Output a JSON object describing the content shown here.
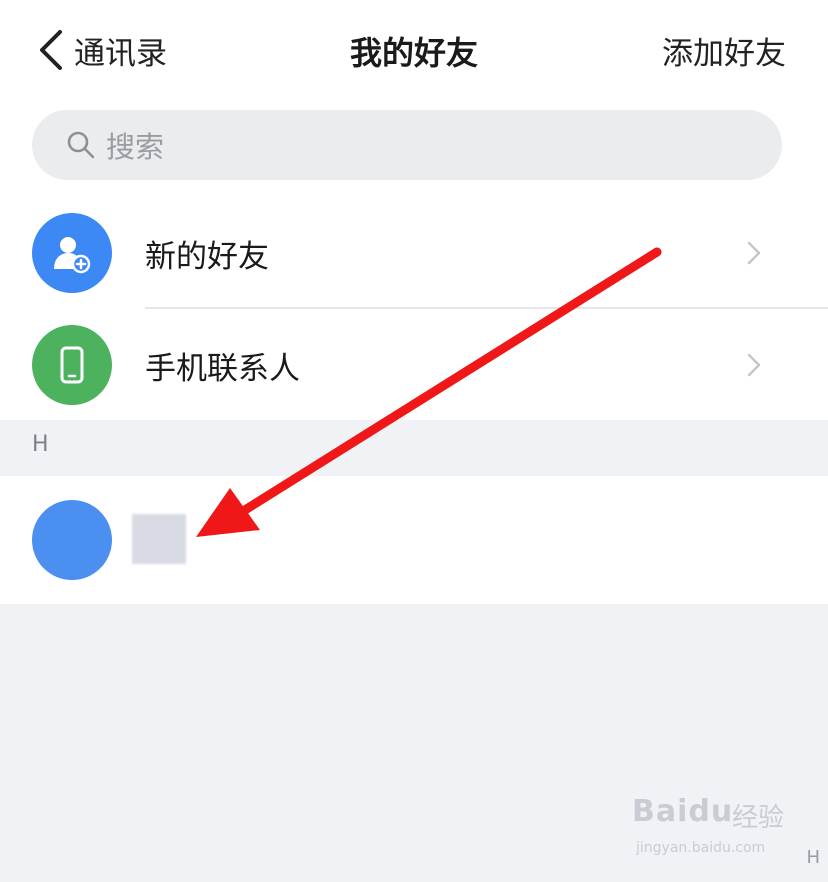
{
  "nav": {
    "back_label": "通讯录",
    "title": "我的好友",
    "action": "添加好友"
  },
  "search": {
    "placeholder": "搜索"
  },
  "menu": {
    "items": [
      {
        "label": "新的好友",
        "icon": "add-user-icon",
        "color": "#3c88f5"
      },
      {
        "label": "手机联系人",
        "icon": "phone-icon",
        "color": "#4cb25d"
      }
    ]
  },
  "section": {
    "letter": "H"
  },
  "contacts": [
    {
      "avatar_color": "#4b8ff0",
      "name": ""
    }
  ],
  "annotation": {
    "arrow_color": "#ef1717"
  },
  "watermark": {
    "brand": "Baidu",
    "suffix": "经验",
    "url": "jingyan.baidu.com"
  },
  "index_letter": "H"
}
